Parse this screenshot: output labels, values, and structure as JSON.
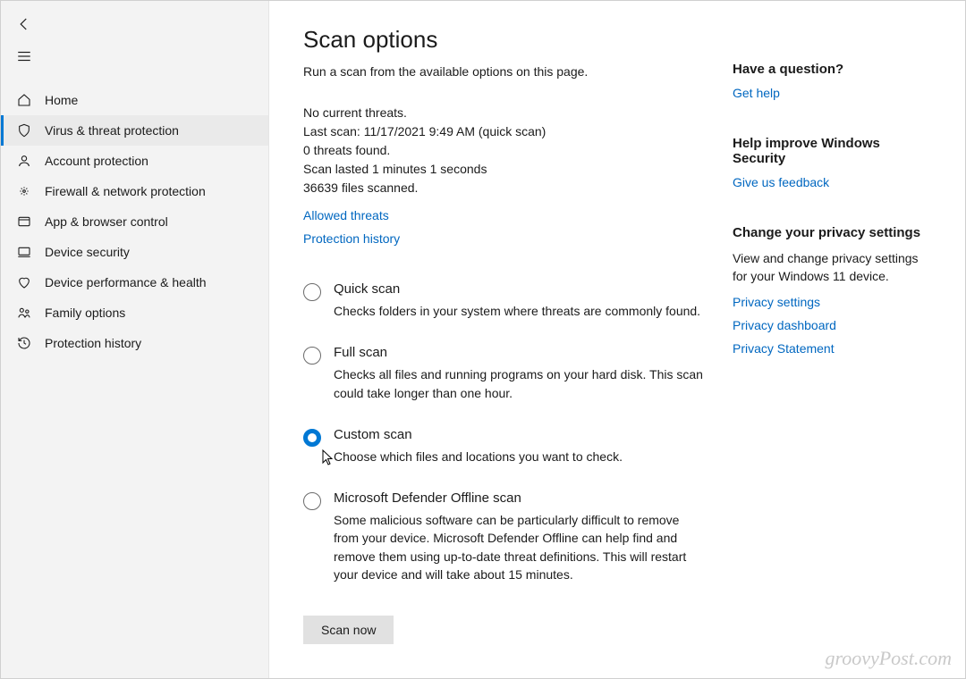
{
  "sidebar": {
    "items": [
      {
        "label": "Home"
      },
      {
        "label": "Virus & threat protection"
      },
      {
        "label": "Account protection"
      },
      {
        "label": "Firewall & network protection"
      },
      {
        "label": "App & browser control"
      },
      {
        "label": "Device security"
      },
      {
        "label": "Device performance & health"
      },
      {
        "label": "Family options"
      },
      {
        "label": "Protection history"
      }
    ]
  },
  "page": {
    "title": "Scan options",
    "subtitle": "Run a scan from the available options on this page."
  },
  "status": {
    "line1": "No current threats.",
    "line2": "Last scan: 11/17/2021 9:49 AM (quick scan)",
    "line3": "0 threats found.",
    "line4": "Scan lasted 1 minutes 1 seconds",
    "line5": "36639 files scanned."
  },
  "links": {
    "allowed": "Allowed threats",
    "history": "Protection history"
  },
  "options": [
    {
      "label": "Quick scan",
      "desc": "Checks folders in your system where threats are commonly found.",
      "selected": false
    },
    {
      "label": "Full scan",
      "desc": "Checks all files and running programs on your hard disk. This scan could take longer than one hour.",
      "selected": false
    },
    {
      "label": "Custom scan",
      "desc": "Choose which files and locations you want to check.",
      "selected": true
    },
    {
      "label": "Microsoft Defender Offline scan",
      "desc": "Some malicious software can be particularly difficult to remove from your device. Microsoft Defender Offline can help find and remove them using up-to-date threat definitions. This will restart your device and will take about 15 minutes.",
      "selected": false
    }
  ],
  "scan_button": "Scan now",
  "right": {
    "question_h": "Have a question?",
    "get_help": "Get help",
    "improve_h": "Help improve Windows Security",
    "feedback": "Give us feedback",
    "privacy_h": "Change your privacy settings",
    "privacy_p": "View and change privacy settings for your Windows 11 device.",
    "priv_settings": "Privacy settings",
    "priv_dash": "Privacy dashboard",
    "priv_stmt": "Privacy Statement"
  },
  "watermark": "groovyPost.com"
}
